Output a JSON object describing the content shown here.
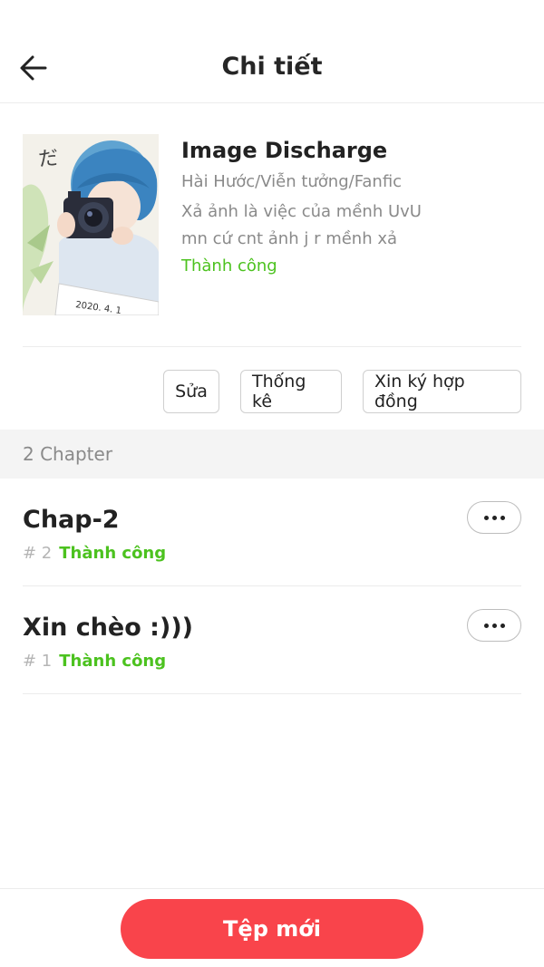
{
  "header": {
    "title": "Chi tiết",
    "back_icon": "arrow-left-icon"
  },
  "story": {
    "title": "Image Discharge",
    "genres": "Hài Hước/Viễn tưởng/Fanfic",
    "description_line1": "Xả ảnh là việc của mềnh UvU",
    "description_line2": "mn cứ cnt ảnh j r mềnh xả",
    "status": "Thành công",
    "cover_caption": "2020. 4. 1"
  },
  "actions": {
    "edit_label": "Sửa",
    "stats_label": "Thống kê",
    "contract_label": "Xin ký hợp đồng"
  },
  "chapters_section": {
    "label": "2 Chapter"
  },
  "chapters": [
    {
      "title": "Chap-2",
      "number": "# 2",
      "status": "Thành công",
      "more_icon": "more-horizontal-icon"
    },
    {
      "title": "Xin chèo :)))",
      "number": "# 1",
      "status": "Thành công",
      "more_icon": "more-horizontal-icon"
    }
  ],
  "footer": {
    "new_label": "Tệp mới"
  },
  "colors": {
    "accent": "#f9444b",
    "success": "#4cc21f",
    "muted": "#8a8a8a"
  }
}
